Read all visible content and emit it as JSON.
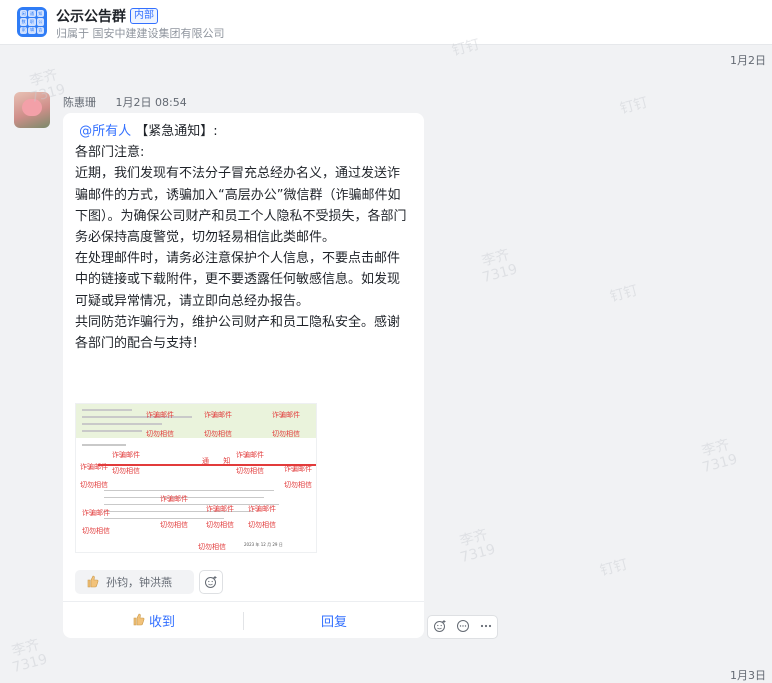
{
  "header": {
    "title": "公示公告群",
    "badge": "内部",
    "subtitle": "归属于 国安中建建设集团有限公司",
    "logo_glyphs": [
      "闲",
      "通",
      "知",
      "数",
      "职",
      "公",
      "家",
      "辑",
      "吉"
    ]
  },
  "date_separators": [
    "1月2日",
    "1月3日"
  ],
  "message": {
    "sender_name": "陈惠珊",
    "timestamp": "1月2日 08:54",
    "mention": "@所有人",
    "line1_rest": " 【紧急通知】:",
    "paragraphs": [
      "各部门注意:",
      "近期，我们发现有不法分子冒充总经办名义，通过发送诈骗邮件的方式，诱骗加入“高层办公”微信群（诈骗邮件如下图）。为确保公司财产和员工个人隐私不受损失，各部门务必保持高度警觉，切勿轻易相信此类邮件。",
      "在处理邮件时，请务必注意保护个人信息，不要点击邮件中的链接或下载附件，更不要透露任何敏感信息。如发现可疑或异常情况，请立即向总经办报告。",
      "共同防范诈骗行为，维护公司财产和员工隐私安全。感谢各部门的配合与支持！"
    ],
    "image": {
      "stamp_scam": "诈骗邮件",
      "stamp_beware": "切勿相信",
      "notice_word": "通 知",
      "date_text": "2023 年 12 月 29 日",
      "stamp_color": "#e23b3b"
    },
    "reaction": {
      "icon": "thumbs-up-icon",
      "users": "孙钧，钟洪燕"
    },
    "actions": {
      "ack_label": "收到",
      "reply_label": "回复"
    }
  },
  "watermark": {
    "lines": [
      "李齐",
      "7319",
      "钉钉"
    ]
  },
  "colors": {
    "accent": "#3370ff",
    "background": "#f1f2f4"
  }
}
